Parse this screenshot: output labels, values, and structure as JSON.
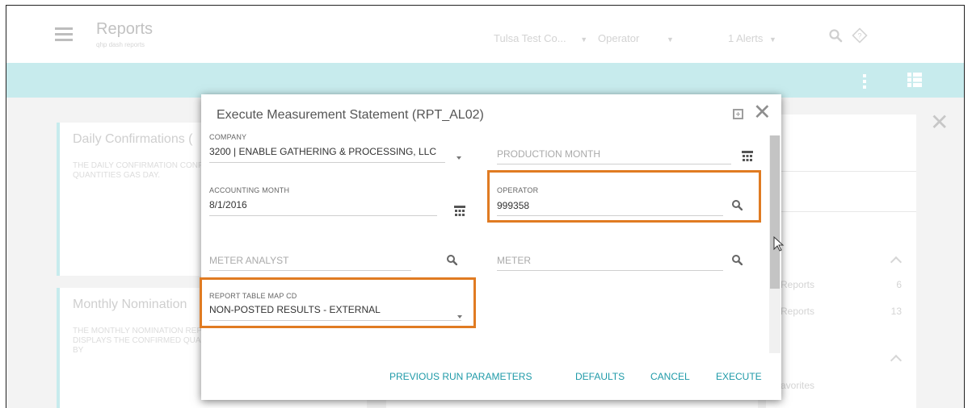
{
  "header": {
    "title": "Reports",
    "breadcrumb": "qhp dash    reports",
    "company_select": "Tulsa Test Co...",
    "role_select": "Operator",
    "alerts": "1 Alerts"
  },
  "background": {
    "cards": [
      {
        "title": "Daily Confirmations (",
        "description": "THE DAILY CONFIRMATION CONFIRMED QUANTITIES GAS DAY."
      },
      {
        "title": "Monthly Nomination",
        "description": "THE MONTHLY NOMINATION REPORT DISPLAYS THE CONFIRMED QUANTITY BY"
      }
    ],
    "right_panel": {
      "rows": [
        {
          "label": "Reports",
          "count": "6"
        },
        {
          "label": "Reports",
          "count": "13"
        },
        {
          "label": "avorites",
          "count": ""
        }
      ]
    }
  },
  "dialog": {
    "title": "Execute Measurement Statement (RPT_AL02)",
    "company": {
      "label": "COMPANY",
      "value": "3200 | ENABLE GATHERING & PROCESSING, LLC"
    },
    "production_month": {
      "placeholder": "PRODUCTION MONTH"
    },
    "accounting_month": {
      "label": "ACCOUNTING MONTH",
      "value": "8/1/2016"
    },
    "operator": {
      "label": "OPERATOR",
      "value": "999358"
    },
    "meter_analyst": {
      "placeholder": "METER ANALYST"
    },
    "meter": {
      "placeholder": "METER"
    },
    "report_table_map": {
      "label": "REPORT TABLE MAP CD",
      "value": "NON-POSTED RESULTS - EXTERNAL"
    },
    "buttons": {
      "previous": "PREVIOUS RUN PARAMETERS",
      "defaults": "DEFAULTS",
      "cancel": "CANCEL",
      "execute": "EXECUTE"
    }
  },
  "colors": {
    "accent": "#1f9aa8",
    "toolbar": "#c7ebed",
    "highlight": "#e07b22"
  }
}
